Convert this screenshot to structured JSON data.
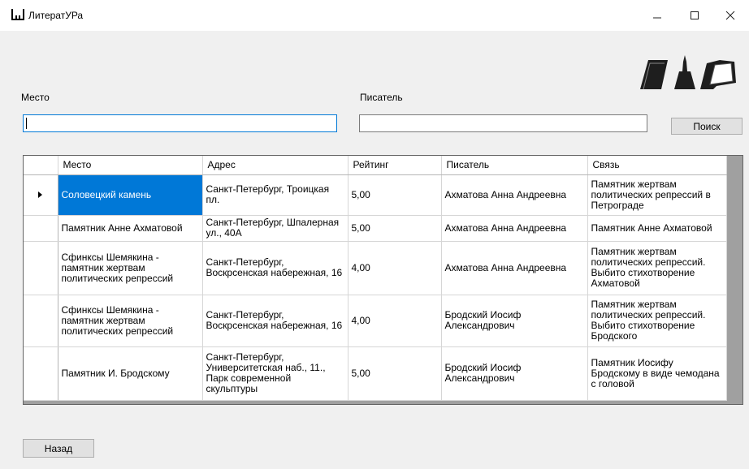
{
  "window": {
    "title": "ЛитератУРа"
  },
  "labels": {
    "place": "Место",
    "writer": "Писатель"
  },
  "inputs": {
    "place_value": "",
    "writer_value": ""
  },
  "buttons": {
    "search": "Поиск",
    "back": "Назад"
  },
  "icons": {
    "minimize": "minimize-icon",
    "maximize": "maximize-icon",
    "close": "close-icon",
    "row_pointer": "row-pointer-icon"
  },
  "colors": {
    "selection": "#0078d7",
    "focus_border": "#0078d7"
  },
  "table": {
    "columns": [
      "Место",
      "Адрес",
      "Рейтинг",
      "Писатель",
      "Связь"
    ],
    "rows": [
      {
        "place": "Соловецкий камень",
        "address": "Санкт-Петербург, Троицкая пл.",
        "rating": "5,00",
        "writer": "Ахматова Анна Андреевна",
        "link": "Памятник жертвам политических репрессий в Петрограде"
      },
      {
        "place": "Памятник Анне Ахматовой",
        "address": "Санкт-Петербург, Шпалерная ул., 40А",
        "rating": "5,00",
        "writer": "Ахматова Анна Андреевна",
        "link": "Памятник Анне Ахматовой"
      },
      {
        "place": "Сфинксы Шемякина - памятник жертвам политических репрессий",
        "address": "Санкт-Петербург, Воскрсенская набережная, 16",
        "rating": "4,00",
        "writer": "Ахматова Анна Андреевна",
        "link": "Памятник жертвам политических репрессий. Выбито стихотворение Ахматовой"
      },
      {
        "place": "Сфинксы Шемякина - памятник жертвам политических репрессий",
        "address": "Санкт-Петербург, Воскрсенская набережная, 16",
        "rating": "4,00",
        "writer": "Бродский Иосиф Александрович",
        "link": "Памятник жертвам политических репрессий. Выбито стихотворение Бродского"
      },
      {
        "place": "Памятник И. Бродскому",
        "address": "Санкт-Петербург, Университетская наб., 11., Парк современной скульптуры",
        "rating": "5,00",
        "writer": "Бродский Иосиф Александрович",
        "link": "Памятник Иосифу Бродскому в виде чемодана с головой"
      }
    ]
  }
}
